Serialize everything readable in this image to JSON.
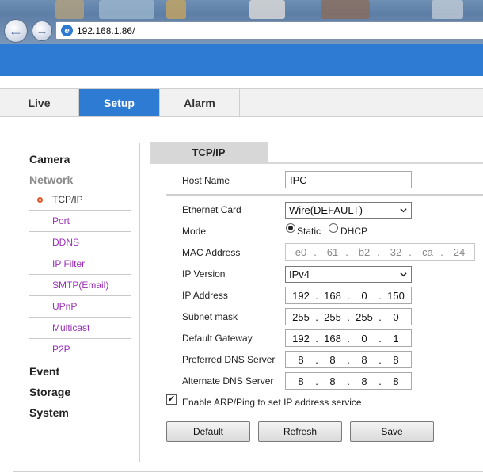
{
  "browser": {
    "url": "192.168.1.86/",
    "back_glyph": "←",
    "forward_glyph": "→",
    "ie_glyph": "e"
  },
  "tabs": [
    "Live",
    "Setup",
    "Alarm"
  ],
  "active_tab": "Setup",
  "sidebar": {
    "camera": "Camera",
    "network": "Network",
    "network_items": [
      "TCP/IP",
      "Port",
      "DDNS",
      "IP Filter",
      "SMTP(Email)",
      "UPnP",
      "Multicast",
      "P2P"
    ],
    "active_item": "TCP/IP",
    "event": "Event",
    "storage": "Storage",
    "system": "System"
  },
  "form": {
    "section_title": "TCP/IP",
    "host_name_label": "Host Name",
    "host_name_value": "IPC",
    "ethernet_card_label": "Ethernet Card",
    "ethernet_card_value": "Wire(DEFAULT)",
    "mode_label": "Mode",
    "mode_static": "Static",
    "mode_dhcp": "DHCP",
    "mode_selected": "Static",
    "mac_label": "MAC Address",
    "mac": [
      "e0",
      "61",
      "b2",
      "32",
      "ca",
      "24"
    ],
    "ip_version_label": "IP Version",
    "ip_version_value": "IPv4",
    "ip_address_label": "IP Address",
    "ip_address": [
      "192",
      "168",
      "0",
      "150"
    ],
    "subnet_label": "Subnet mask",
    "subnet": [
      "255",
      "255",
      "255",
      "0"
    ],
    "gateway_label": "Default Gateway",
    "gateway": [
      "192",
      "168",
      "0",
      "1"
    ],
    "pref_dns_label": "Preferred DNS Server",
    "pref_dns": [
      "8",
      "8",
      "8",
      "8"
    ],
    "alt_dns_label": "Alternate DNS Server",
    "alt_dns": [
      "8",
      "8",
      "8",
      "8"
    ],
    "arp_label": "Enable ARP/Ping to set IP address service",
    "arp_checked": true,
    "check_glyph": "✔"
  },
  "buttons": {
    "default": "Default",
    "refresh": "Refresh",
    "save": "Save"
  },
  "colors": {
    "accent": "#2e7bd3",
    "link": "#9b2fb7",
    "active_dot": "#e2501f"
  }
}
